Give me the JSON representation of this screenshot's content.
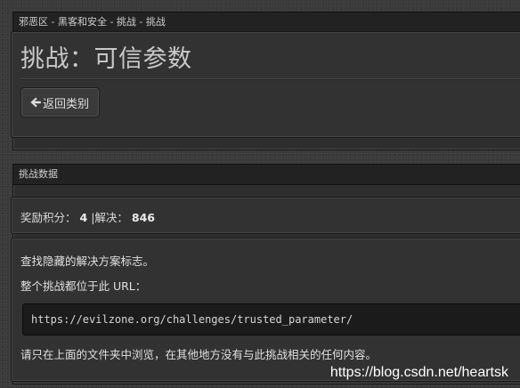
{
  "header_panel": {
    "breadcrumb": "邪恶区 - 黑客和安全 - 挑战 - 挑战",
    "title": "挑战：可信参数",
    "back_button_label": "返回类别",
    "back_icon": "arrow-left-icon"
  },
  "data_panel": {
    "heading": "挑战数据",
    "points_label": "奖励积分：",
    "points_value": "4",
    "separator": "|",
    "solves_label": "解决：",
    "solves_value": "846",
    "instruction_1": "查找隐藏的解决方案标志。",
    "instruction_2": "整个挑战都位于此 URL：",
    "challenge_url": "https://evilzone.org/challenges/trusted_parameter/",
    "instruction_3": "请只在上面的文件夹中浏览，在其他地方没有与此挑战相关的任何内容。"
  },
  "watermark": "https://blog.csdn.net/heartsk",
  "colors": {
    "background": "#3a3a3a",
    "panel": "#2e2e2e",
    "panel_header": "#222222",
    "code_box": "#1b1b1b",
    "text": "#d8d8d8"
  }
}
